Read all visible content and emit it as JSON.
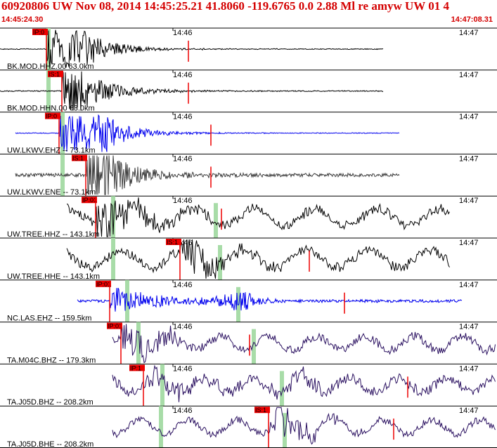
{
  "header": {
    "title": "60920806 UW Nov 08, 2014 14:45:25.21   41.8060 -119.6765  0.0 2.88 Ml re amyw UW 01   4",
    "start_time": "14:45:24.30",
    "end_time": "14:47:08.31"
  },
  "minute_labels": {
    "first": "14:46",
    "second": "14:47"
  },
  "colors": {
    "black": "#000000",
    "blue": "#0000ee",
    "gray": "#404040",
    "purple": "#2a1060",
    "red": "#ee0000",
    "green": "#a8dca8"
  },
  "traces": [
    {
      "label": "BK.MOD.HHZ.00 63.0km",
      "color": "black",
      "picks": [
        "IP:0"
      ]
    },
    {
      "label": "BK.MOD.HHN.00 63.0km",
      "color": "black",
      "picks": [
        "IS:1"
      ]
    },
    {
      "label": "UW.LKWV.EHZ -- 73.1km",
      "color": "blue",
      "picks": [
        "IP:0"
      ]
    },
    {
      "label": "UW.LKWV.ENE -- 73.1km",
      "color": "gray",
      "picks": [
        "IS:1"
      ]
    },
    {
      "label": "UW.TREE.HHZ -- 143.1km",
      "color": "black",
      "picks": [
        "IP:01"
      ]
    },
    {
      "label": "UW.TREE.HHE -- 143.1km",
      "color": "black",
      "picks": [
        "IS:1"
      ]
    },
    {
      "label": "NC.LAS.EHZ -- 159.5km",
      "color": "blue",
      "picks": [
        "IP:01"
      ]
    },
    {
      "label": "TA.M04C.BHZ -- 179.3km",
      "color": "purple",
      "picks": [
        "IP:01"
      ]
    },
    {
      "label": "TA.J05D.BHZ -- 208.2km",
      "color": "purple",
      "picks": [
        "IP:1"
      ]
    },
    {
      "label": "TA.J05D.BHE -- 208.2km",
      "color": "purple",
      "picks": [
        "IS:1"
      ]
    }
  ]
}
